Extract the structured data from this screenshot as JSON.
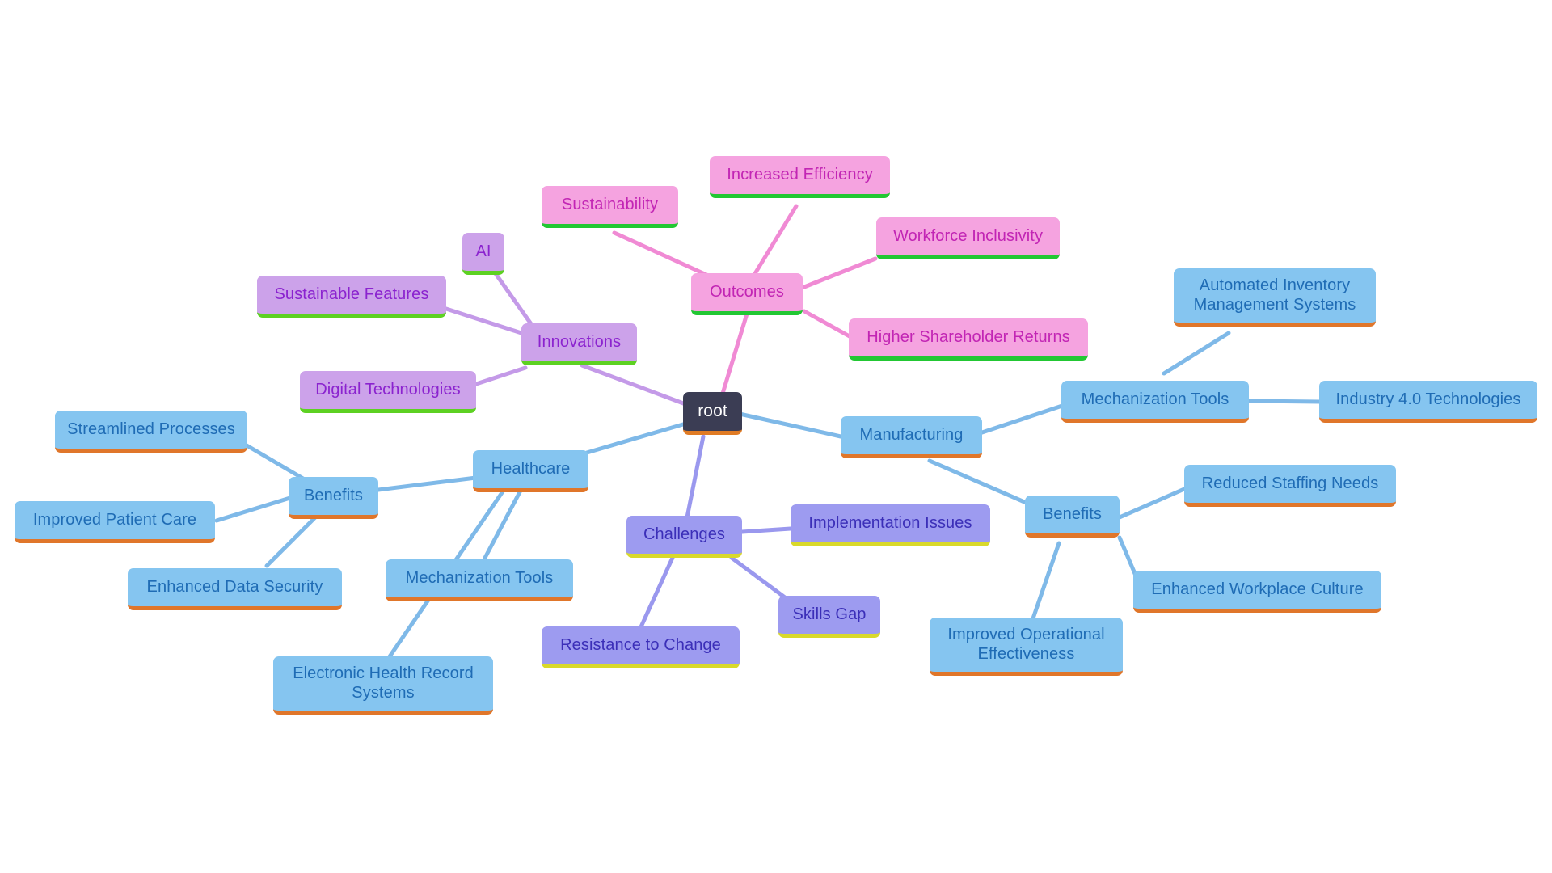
{
  "diagram": {
    "type": "mindmap",
    "title": "root",
    "background": "#ffffff",
    "palette": {
      "root_fill": "#3b3d54",
      "root_text": "#ffffff",
      "root_accent": "#e07b24",
      "blue_fill": "#85c5f0",
      "blue_text": "#1f6cb5",
      "blue_accent": "#e0762a",
      "pink_fill": "#f5a3e0",
      "pink_text": "#c225b4",
      "pink_accent": "#22c733",
      "violet_fill": "#cca2ea",
      "violet_text": "#8b23cf",
      "violet_accent": "#5dd122",
      "peri_fill": "#9d9bf0",
      "peri_text": "#3b2fb8",
      "peri_accent": "#d9d92b"
    }
  },
  "nodes": {
    "root": {
      "label": "root"
    },
    "outcomes": {
      "label": "Outcomes"
    },
    "increased_efficiency": {
      "label": "Increased Efficiency"
    },
    "sustainability": {
      "label": "Sustainability"
    },
    "workforce_inclusivity": {
      "label": "Workforce Inclusivity"
    },
    "higher_shareholder_returns": {
      "label": "Higher Shareholder Returns"
    },
    "innovations": {
      "label": "Innovations"
    },
    "ai": {
      "label": "AI"
    },
    "sustainable_features": {
      "label": "Sustainable Features"
    },
    "digital_technologies": {
      "label": "Digital Technologies"
    },
    "healthcare": {
      "label": "Healthcare"
    },
    "healthcare_benefits": {
      "label": "Benefits"
    },
    "streamlined_processes": {
      "label": "Streamlined Processes"
    },
    "improved_patient_care": {
      "label": "Improved Patient Care"
    },
    "enhanced_data_security": {
      "label": "Enhanced Data Security"
    },
    "healthcare_mechanization_tools": {
      "label": "Mechanization Tools"
    },
    "electronic_health_record_systems": {
      "label": "Electronic Health Record\nSystems"
    },
    "manufacturing": {
      "label": "Manufacturing"
    },
    "manufacturing_mechanization_tools": {
      "label": "Mechanization Tools"
    },
    "automated_inventory": {
      "label": "Automated Inventory\nManagement Systems"
    },
    "industry_40": {
      "label": "Industry 4.0 Technologies"
    },
    "manufacturing_benefits": {
      "label": "Benefits"
    },
    "reduced_staffing_needs": {
      "label": "Reduced Staffing Needs"
    },
    "enhanced_workplace_culture": {
      "label": "Enhanced Workplace Culture"
    },
    "improved_operational_effectiveness": {
      "label": "Improved Operational\nEffectiveness"
    },
    "challenges": {
      "label": "Challenges"
    },
    "implementation_issues": {
      "label": "Implementation Issues"
    },
    "skills_gap": {
      "label": "Skills Gap"
    },
    "resistance_to_change": {
      "label": "Resistance to Change"
    }
  }
}
